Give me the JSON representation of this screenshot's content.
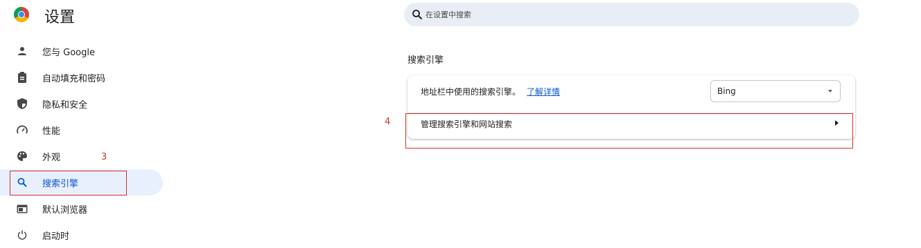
{
  "app": {
    "title": "设置"
  },
  "search": {
    "placeholder": "在设置中搜索"
  },
  "sidebar": {
    "items": [
      {
        "label": "您与 Google",
        "icon": "person-icon"
      },
      {
        "label": "自动填充和密码",
        "icon": "clipboard-icon"
      },
      {
        "label": "隐私和安全",
        "icon": "shield-icon"
      },
      {
        "label": "性能",
        "icon": "speedometer-icon"
      },
      {
        "label": "外观",
        "icon": "palette-icon"
      },
      {
        "label": "搜索引擎",
        "icon": "search-icon",
        "active": true
      },
      {
        "label": "默认浏览器",
        "icon": "browser-icon"
      },
      {
        "label": "启动时",
        "icon": "power-icon"
      }
    ]
  },
  "main": {
    "section_title": "搜索引擎",
    "address_bar_label": "地址栏中使用的搜索引擎。",
    "learn_more": "了解详情",
    "engine_value": "Bing",
    "manage_label": "管理搜索引擎和网站搜索"
  },
  "annotations": {
    "step3": "3",
    "step4": "4"
  },
  "colors": {
    "accent": "#0b57d0",
    "active_bg": "#e8effd",
    "annotation": "#d32f2f"
  }
}
